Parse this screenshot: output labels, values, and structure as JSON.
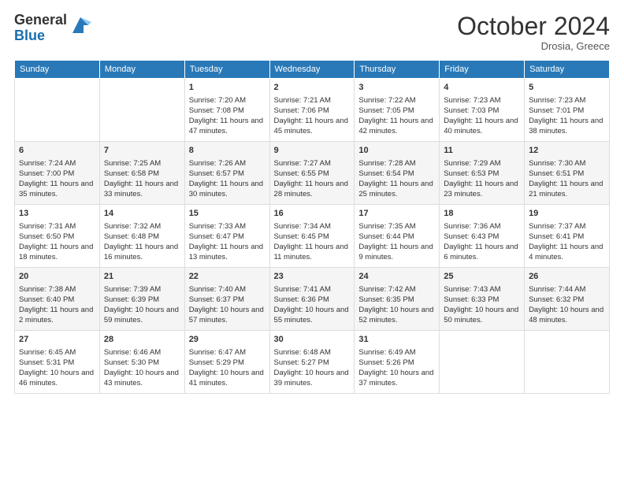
{
  "header": {
    "logo_general": "General",
    "logo_blue": "Blue",
    "month_title": "October 2024",
    "location": "Drosia, Greece"
  },
  "days_of_week": [
    "Sunday",
    "Monday",
    "Tuesday",
    "Wednesday",
    "Thursday",
    "Friday",
    "Saturday"
  ],
  "weeks": [
    [
      {
        "day": "",
        "info": ""
      },
      {
        "day": "",
        "info": ""
      },
      {
        "day": "1",
        "info": "Sunrise: 7:20 AM\nSunset: 7:08 PM\nDaylight: 11 hours and 47 minutes."
      },
      {
        "day": "2",
        "info": "Sunrise: 7:21 AM\nSunset: 7:06 PM\nDaylight: 11 hours and 45 minutes."
      },
      {
        "day": "3",
        "info": "Sunrise: 7:22 AM\nSunset: 7:05 PM\nDaylight: 11 hours and 42 minutes."
      },
      {
        "day": "4",
        "info": "Sunrise: 7:23 AM\nSunset: 7:03 PM\nDaylight: 11 hours and 40 minutes."
      },
      {
        "day": "5",
        "info": "Sunrise: 7:23 AM\nSunset: 7:01 PM\nDaylight: 11 hours and 38 minutes."
      }
    ],
    [
      {
        "day": "6",
        "info": "Sunrise: 7:24 AM\nSunset: 7:00 PM\nDaylight: 11 hours and 35 minutes."
      },
      {
        "day": "7",
        "info": "Sunrise: 7:25 AM\nSunset: 6:58 PM\nDaylight: 11 hours and 33 minutes."
      },
      {
        "day": "8",
        "info": "Sunrise: 7:26 AM\nSunset: 6:57 PM\nDaylight: 11 hours and 30 minutes."
      },
      {
        "day": "9",
        "info": "Sunrise: 7:27 AM\nSunset: 6:55 PM\nDaylight: 11 hours and 28 minutes."
      },
      {
        "day": "10",
        "info": "Sunrise: 7:28 AM\nSunset: 6:54 PM\nDaylight: 11 hours and 25 minutes."
      },
      {
        "day": "11",
        "info": "Sunrise: 7:29 AM\nSunset: 6:53 PM\nDaylight: 11 hours and 23 minutes."
      },
      {
        "day": "12",
        "info": "Sunrise: 7:30 AM\nSunset: 6:51 PM\nDaylight: 11 hours and 21 minutes."
      }
    ],
    [
      {
        "day": "13",
        "info": "Sunrise: 7:31 AM\nSunset: 6:50 PM\nDaylight: 11 hours and 18 minutes."
      },
      {
        "day": "14",
        "info": "Sunrise: 7:32 AM\nSunset: 6:48 PM\nDaylight: 11 hours and 16 minutes."
      },
      {
        "day": "15",
        "info": "Sunrise: 7:33 AM\nSunset: 6:47 PM\nDaylight: 11 hours and 13 minutes."
      },
      {
        "day": "16",
        "info": "Sunrise: 7:34 AM\nSunset: 6:45 PM\nDaylight: 11 hours and 11 minutes."
      },
      {
        "day": "17",
        "info": "Sunrise: 7:35 AM\nSunset: 6:44 PM\nDaylight: 11 hours and 9 minutes."
      },
      {
        "day": "18",
        "info": "Sunrise: 7:36 AM\nSunset: 6:43 PM\nDaylight: 11 hours and 6 minutes."
      },
      {
        "day": "19",
        "info": "Sunrise: 7:37 AM\nSunset: 6:41 PM\nDaylight: 11 hours and 4 minutes."
      }
    ],
    [
      {
        "day": "20",
        "info": "Sunrise: 7:38 AM\nSunset: 6:40 PM\nDaylight: 11 hours and 2 minutes."
      },
      {
        "day": "21",
        "info": "Sunrise: 7:39 AM\nSunset: 6:39 PM\nDaylight: 10 hours and 59 minutes."
      },
      {
        "day": "22",
        "info": "Sunrise: 7:40 AM\nSunset: 6:37 PM\nDaylight: 10 hours and 57 minutes."
      },
      {
        "day": "23",
        "info": "Sunrise: 7:41 AM\nSunset: 6:36 PM\nDaylight: 10 hours and 55 minutes."
      },
      {
        "day": "24",
        "info": "Sunrise: 7:42 AM\nSunset: 6:35 PM\nDaylight: 10 hours and 52 minutes."
      },
      {
        "day": "25",
        "info": "Sunrise: 7:43 AM\nSunset: 6:33 PM\nDaylight: 10 hours and 50 minutes."
      },
      {
        "day": "26",
        "info": "Sunrise: 7:44 AM\nSunset: 6:32 PM\nDaylight: 10 hours and 48 minutes."
      }
    ],
    [
      {
        "day": "27",
        "info": "Sunrise: 6:45 AM\nSunset: 5:31 PM\nDaylight: 10 hours and 46 minutes."
      },
      {
        "day": "28",
        "info": "Sunrise: 6:46 AM\nSunset: 5:30 PM\nDaylight: 10 hours and 43 minutes."
      },
      {
        "day": "29",
        "info": "Sunrise: 6:47 AM\nSunset: 5:29 PM\nDaylight: 10 hours and 41 minutes."
      },
      {
        "day": "30",
        "info": "Sunrise: 6:48 AM\nSunset: 5:27 PM\nDaylight: 10 hours and 39 minutes."
      },
      {
        "day": "31",
        "info": "Sunrise: 6:49 AM\nSunset: 5:26 PM\nDaylight: 10 hours and 37 minutes."
      },
      {
        "day": "",
        "info": ""
      },
      {
        "day": "",
        "info": ""
      }
    ]
  ]
}
